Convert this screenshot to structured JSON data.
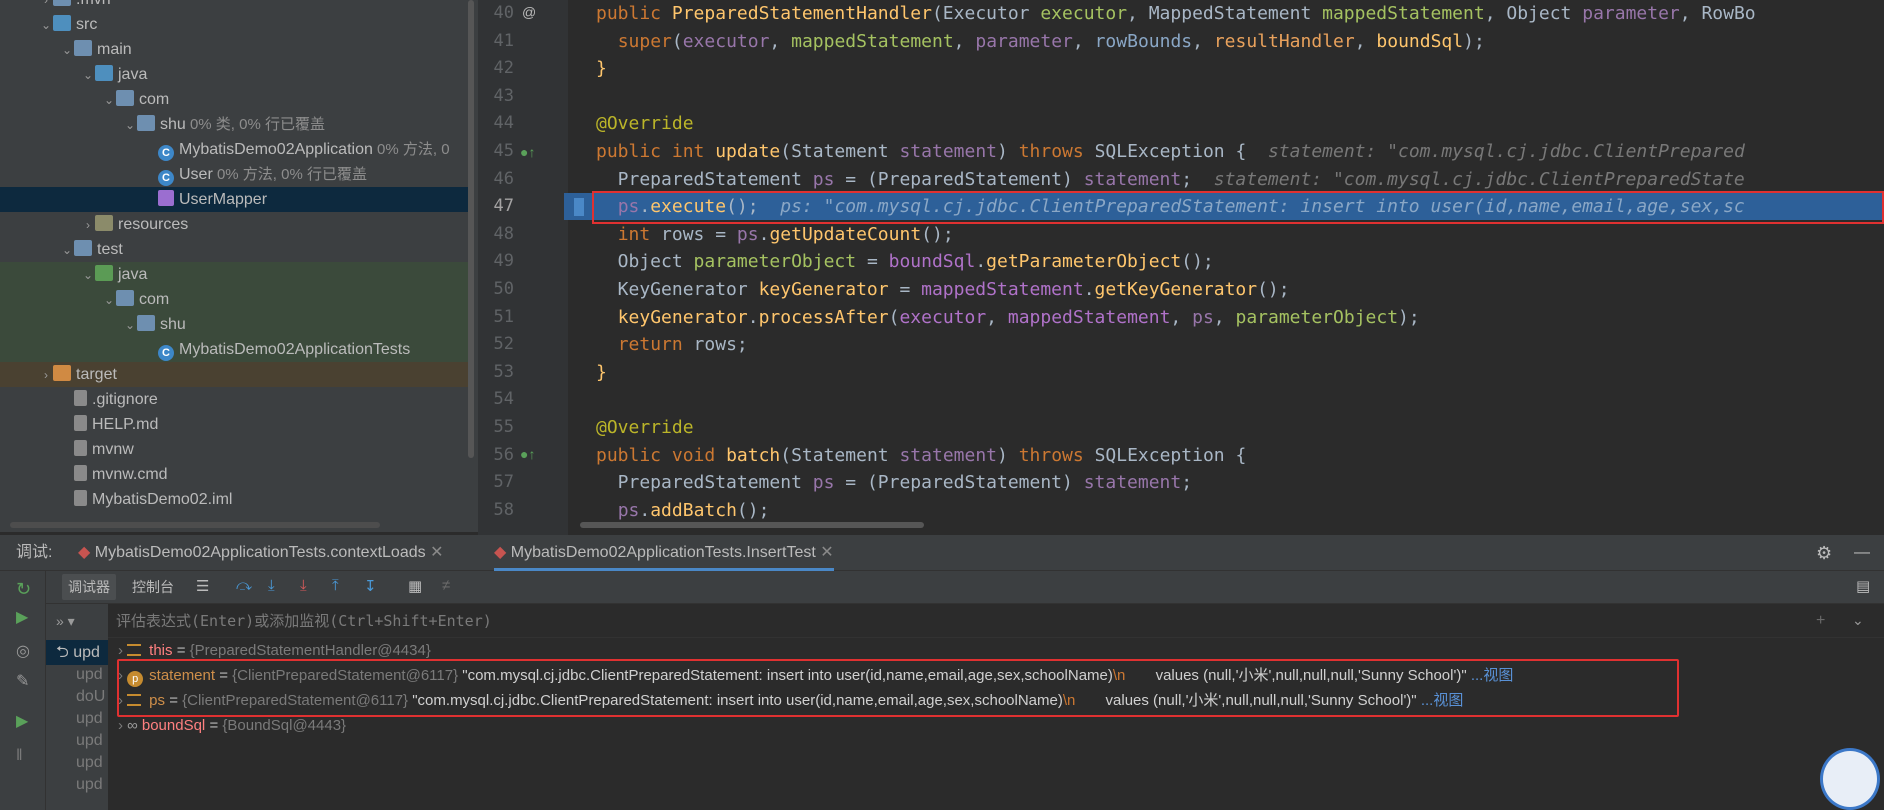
{
  "project_tree": [
    {
      "indent": 1,
      "arrow": "›",
      "icon": "folder",
      "label": ".mvn"
    },
    {
      "indent": 1,
      "arrow": "⌄",
      "icon": "folder-src",
      "label": "src"
    },
    {
      "indent": 2,
      "arrow": "⌄",
      "icon": "folder",
      "label": "main"
    },
    {
      "indent": 3,
      "arrow": "⌄",
      "icon": "folder-src",
      "label": "java"
    },
    {
      "indent": 4,
      "arrow": "⌄",
      "icon": "package",
      "label": "com"
    },
    {
      "indent": 5,
      "arrow": "⌄",
      "icon": "package",
      "label": "shu",
      "coverage": "0% 类, 0% 行已覆盖"
    },
    {
      "indent": 6,
      "arrow": "",
      "icon": "class",
      "label": "MybatisDemo02Application",
      "coverage": "0% 方法, 0"
    },
    {
      "indent": 6,
      "arrow": "",
      "icon": "class",
      "label": "User",
      "coverage": "0% 方法, 0% 行已覆盖"
    },
    {
      "indent": 6,
      "arrow": "",
      "icon": "mapper",
      "label": "UserMapper",
      "selected": true
    },
    {
      "indent": 3,
      "arrow": "›",
      "icon": "folder-res",
      "label": "resources"
    },
    {
      "indent": 2,
      "arrow": "⌄",
      "icon": "folder",
      "label": "test"
    },
    {
      "indent": 3,
      "arrow": "⌄",
      "icon": "folder-test",
      "label": "java",
      "green": true
    },
    {
      "indent": 4,
      "arrow": "⌄",
      "icon": "package",
      "label": "com",
      "green": true
    },
    {
      "indent": 5,
      "arrow": "⌄",
      "icon": "package",
      "label": "shu",
      "green": true
    },
    {
      "indent": 6,
      "arrow": "",
      "icon": "class",
      "label": "MybatisDemo02ApplicationTests",
      "green": true
    },
    {
      "indent": 1,
      "arrow": "›",
      "icon": "folder-orange",
      "label": "target",
      "brown": true
    },
    {
      "indent": 2,
      "arrow": "",
      "icon": "file",
      "label": ".gitignore"
    },
    {
      "indent": 2,
      "arrow": "",
      "icon": "file",
      "label": "HELP.md"
    },
    {
      "indent": 2,
      "arrow": "",
      "icon": "file",
      "label": "mvnw"
    },
    {
      "indent": 2,
      "arrow": "",
      "icon": "file",
      "label": "mvnw.cmd"
    },
    {
      "indent": 2,
      "arrow": "",
      "icon": "file",
      "label": "MybatisDemo02.iml"
    }
  ],
  "editor": {
    "line_numbers": [
      "40",
      "41",
      "42",
      "43",
      "44",
      "45",
      "46",
      "47",
      "48",
      "49",
      "50",
      "51",
      "52",
      "53",
      "54",
      "55",
      "56",
      "57",
      "58"
    ],
    "current_line": "47"
  },
  "debug": {
    "label": "调试:",
    "tab1": "MybatisDemo02ApplicationTests.contextLoads",
    "tab2": "MybatisDemo02ApplicationTests.InsertTest",
    "subtab_debugger": "调试器",
    "subtab_console": "控制台",
    "eval_placeholder": "评估表达式(Enter)或添加监视(Ctrl+Shift+Enter)",
    "frames": [
      "upd",
      "upd",
      "doU",
      "upd",
      "upd",
      "upd",
      "upd"
    ],
    "vars": {
      "this_name": "this",
      "this_val": "{PreparedStatementHandler@4434}",
      "statement_name": "statement",
      "statement_type": "{ClientPreparedStatement@6117}",
      "statement_str": "\"com.mysql.cj.jdbc.ClientPreparedStatement: insert into user(id,name,email,age,sex,schoolName)",
      "statement_tail": "values (null,'小米',null,null,null,'Sunny School')\"",
      "ps_name": "ps",
      "ps_type": "{ClientPreparedStatement@6117}",
      "ps_str": "\"com.mysql.cj.jdbc.ClientPreparedStatement: insert into user(id,name,email,age,sex,schoolName)",
      "ps_tail": "values (null,'小米',null,null,null,'Sunny School')\"",
      "newline": "\\n",
      "view_link": "...视图",
      "bound_name": "boundSql",
      "bound_val": "{BoundSql@4443}",
      "eq": "="
    }
  },
  "colors": {
    "accent": "#2d6099",
    "highlight_border": "#e03131"
  }
}
